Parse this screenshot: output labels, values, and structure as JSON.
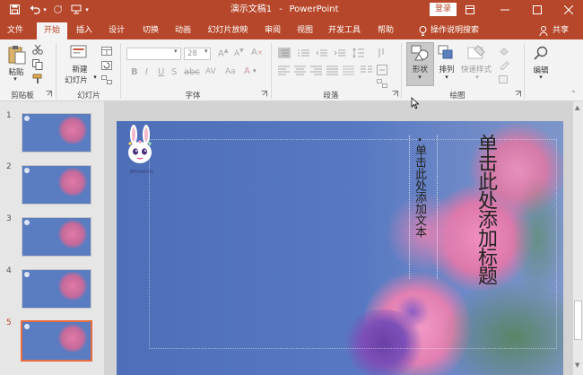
{
  "titlebar": {
    "title": "演示文稿1",
    "separator": "-",
    "app_name": "PowerPoint",
    "login_label": "登录"
  },
  "tabs": [
    "文件",
    "开始",
    "插入",
    "设计",
    "切换",
    "动画",
    "幻灯片放映",
    "审阅",
    "视图",
    "开发工具",
    "帮助",
    "操作说明搜索",
    "共享"
  ],
  "ribbon": {
    "clipboard": {
      "paste_label": "粘贴",
      "group_label": "剪贴板"
    },
    "slides": {
      "new_slide_line1": "新建",
      "new_slide_line2": "幻灯片",
      "group_label": "幻灯片"
    },
    "font": {
      "size_value": "28",
      "group_label": "字体"
    },
    "paragraph": {
      "group_label": "段落"
    },
    "drawing": {
      "shape_label": "形状",
      "arrange_label": "排列",
      "quick_style_label": "快速样式",
      "group_label": "绘图"
    },
    "editing": {
      "edit_label": "编辑"
    }
  },
  "thumbnails": [
    {
      "num": "1"
    },
    {
      "num": "2"
    },
    {
      "num": "3"
    },
    {
      "num": "4"
    },
    {
      "num": "5"
    }
  ],
  "slide": {
    "title_placeholder": "单击此处添加标题",
    "body_bullet": "•",
    "body_placeholder": "单击此处添加文本",
    "logo_text": "Whitehills"
  },
  "colors": {
    "accent": "#b7472a",
    "ribbon_bg": "#f3f3f3",
    "selected_thumb": "#e86a3e"
  }
}
